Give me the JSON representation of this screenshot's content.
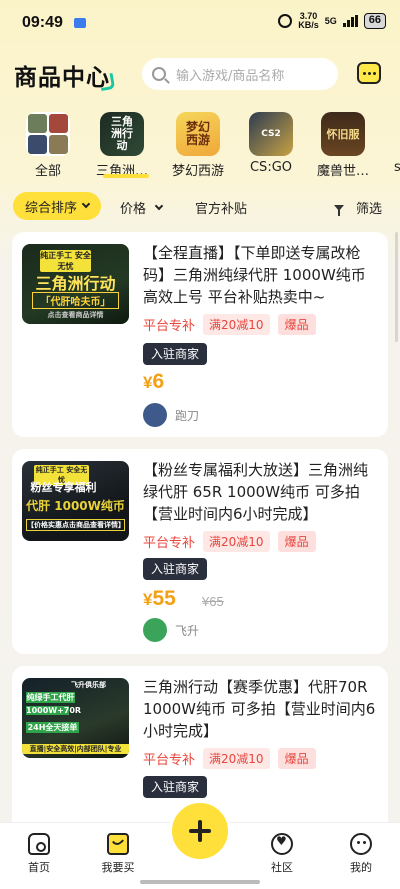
{
  "status_bar": {
    "time": "09:49",
    "net_speed": "3.70",
    "net_unit": "KB/s",
    "network": "5G",
    "battery": "66"
  },
  "header": {
    "title": "商品中心",
    "search_placeholder": "输入游戏/商品名称"
  },
  "games": [
    {
      "name": "全部",
      "icon": "all-games-icon"
    },
    {
      "name": "三角洲…",
      "icon": "delta-force-icon",
      "thumb_text": "三角洲行动",
      "selected": true
    },
    {
      "name": "梦幻西游",
      "icon": "fantasy-westward-icon",
      "thumb_text": "梦幻西游"
    },
    {
      "name": "CS:GO",
      "icon": "csgo-icon",
      "thumb_text": "CS2"
    },
    {
      "name": "魔兽世…",
      "icon": "wow-icon",
      "thumb_text": "怀旧服"
    }
  ],
  "games_edge_char": "s",
  "sort_bar": {
    "default_sort": "综合排序",
    "price": "价格",
    "subsidy": "官方补贴",
    "filter": "筛选"
  },
  "products": [
    {
      "title": "【全程直播】【下单即送专属改枪码】三角洲纯绿代肝 1000W纯币 高效上号 平台补贴热卖中~",
      "image_text": [
        "纯正手工 安全无忧",
        "三角洲行动",
        "「代肝哈夫币」",
        "点击查看商品详情"
      ],
      "tag_subsidy": "平台专补",
      "tag_discount": "满20减10",
      "tag_hot": "爆品",
      "merchant": "入驻商家",
      "currency": "¥",
      "price": "6",
      "old_price": "",
      "seller": "跑刀"
    },
    {
      "title": "【粉丝专属福利大放送】三角洲纯绿代肝 65R 1000W纯币 可多拍【营业时间内6小时完成】",
      "image_text": [
        "纯正手工 安全无忧",
        "粉丝专享福利",
        "代肝 1000W纯币",
        "【价格实惠点击商品查看详情】"
      ],
      "tag_subsidy": "平台专补",
      "tag_discount": "满20减10",
      "tag_hot": "爆品",
      "merchant": "入驻商家",
      "currency": "¥",
      "price": "55",
      "old_price": "¥65",
      "seller": "飞升"
    },
    {
      "title": "三角洲行动【赛季优惠】代肝70R 1000W纯币 可多拍【营业时间内6小时完成】",
      "image_text": [
        "飞升俱乐部",
        "纯绿手工代肝",
        "1000W+70R",
        "24H全天接单",
        "直播|安全高效|内部团队|专业"
      ],
      "tag_subsidy": "平台专补",
      "tag_discount": "满20减10",
      "tag_hot": "爆品",
      "merchant": "入驻商家",
      "currency": "¥",
      "price": "",
      "old_price": "",
      "seller": ""
    }
  ],
  "bottom_nav": {
    "home": "首页",
    "buy": "我要买",
    "community": "社区",
    "mine": "我的"
  },
  "colors": {
    "accent_yellow": "#ffe03a",
    "price_orange": "#f2a116",
    "tag_red": "#e8453c",
    "merchant_dark": "#2a2f3e"
  }
}
